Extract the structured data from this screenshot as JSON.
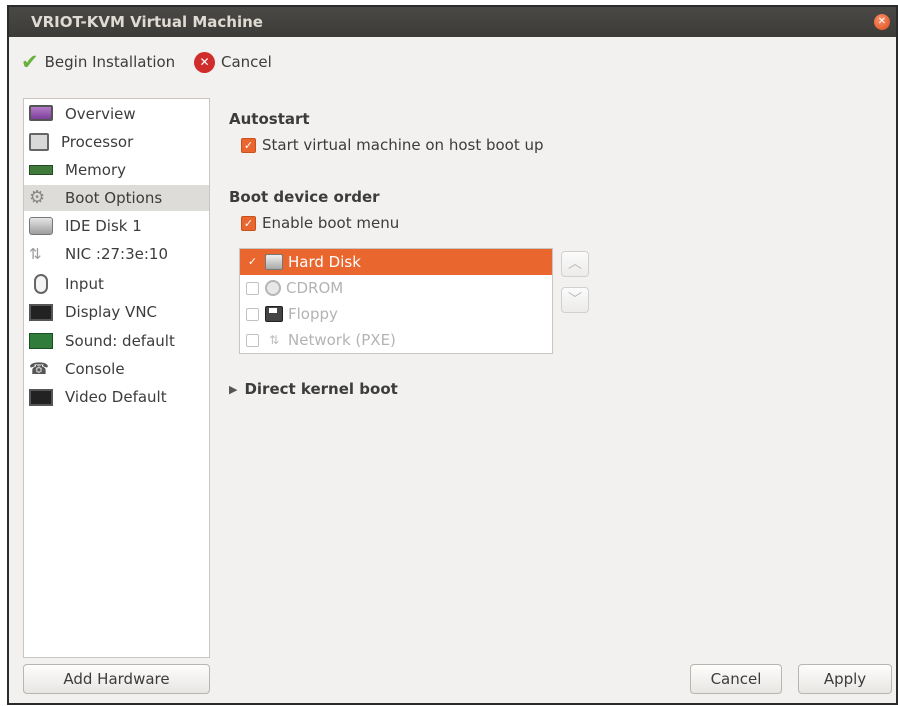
{
  "window": {
    "title": "VRIOT-KVM Virtual Machine",
    "close_icon": "close-icon"
  },
  "toolbar": {
    "begin_label": "Begin Installation",
    "cancel_label": "Cancel"
  },
  "sidebar": {
    "items": [
      {
        "label": "Overview",
        "icon": "monitor-icon"
      },
      {
        "label": "Processor",
        "icon": "processor-icon"
      },
      {
        "label": "Memory",
        "icon": "memory-icon"
      },
      {
        "label": "Boot Options",
        "icon": "gears-icon",
        "selected": true
      },
      {
        "label": "IDE Disk 1",
        "icon": "disk-icon"
      },
      {
        "label": "NIC :27:3e:10",
        "icon": "network-icon"
      },
      {
        "label": "Input",
        "icon": "mouse-icon"
      },
      {
        "label": "Display VNC",
        "icon": "display-icon"
      },
      {
        "label": "Sound: default",
        "icon": "sound-card-icon"
      },
      {
        "label": "Console",
        "icon": "console-icon"
      },
      {
        "label": "Video Default",
        "icon": "video-icon"
      }
    ]
  },
  "autostart": {
    "title": "Autostart",
    "checkbox_label": "Start virtual machine on host boot up",
    "checked": true
  },
  "boot_order": {
    "title": "Boot device order",
    "enable_menu_label": "Enable boot menu",
    "enable_menu_checked": true,
    "devices": [
      {
        "label": "Hard Disk",
        "checked": true,
        "selected": true,
        "icon": "hard-disk-icon"
      },
      {
        "label": "CDROM",
        "checked": false,
        "icon": "cdrom-icon"
      },
      {
        "label": "Floppy",
        "checked": false,
        "icon": "floppy-icon"
      },
      {
        "label": "Network (PXE)",
        "checked": false,
        "icon": "network-icon"
      }
    ],
    "move_up_icon": "chevron-up-icon",
    "move_down_icon": "chevron-down-icon"
  },
  "direct_kernel": {
    "label": "Direct kernel boot",
    "expanded": false
  },
  "footer": {
    "add_hardware_label": "Add Hardware",
    "cancel_label": "Cancel",
    "apply_label": "Apply"
  },
  "colors": {
    "accent": "#e9672f",
    "titlebar": "#3c3b37",
    "window_bg": "#f2f1f0"
  }
}
